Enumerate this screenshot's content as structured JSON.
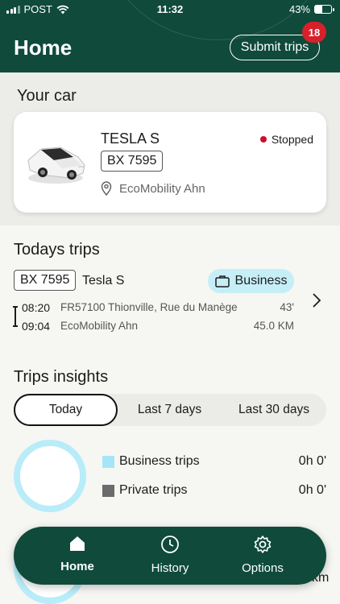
{
  "status_bar": {
    "carrier": "POST",
    "time": "11:32",
    "battery": "43%",
    "battery_fraction": 0.43
  },
  "header": {
    "title": "Home",
    "submit_label": "Submit trips",
    "badge_count": "18"
  },
  "your_car": {
    "section_title": "Your car",
    "name": "TESLA S",
    "plate": "BX 7595",
    "status": "Stopped",
    "location": "EcoMobility Ahn"
  },
  "todays_trips": {
    "section_title": "Todays trips",
    "plate": "BX 7595",
    "car": "Tesla S",
    "category": "Business",
    "start_time": "08:20",
    "start_place": "FR57100 Thionville, Rue du Manège",
    "duration": "43'",
    "end_time": "09:04",
    "end_place": "EcoMobility Ahn",
    "distance": "45.0 KM"
  },
  "insights": {
    "section_title": "Trips insights",
    "tabs": [
      "Today",
      "Last 7 days",
      "Last 30 days"
    ],
    "active_tab": "Today",
    "legend": [
      {
        "label": "Business trips",
        "value": "0h 0'",
        "color": "#a5e6f6"
      },
      {
        "label": "Private trips",
        "value": "0h 0'",
        "color": "#6b6b6b"
      }
    ],
    "partial_value": "km"
  },
  "nav": {
    "items": [
      {
        "label": "Home",
        "icon": "home-icon"
      },
      {
        "label": "History",
        "icon": "clock-icon"
      },
      {
        "label": "Options",
        "icon": "gear-icon"
      }
    ]
  },
  "colors": {
    "brand": "#0f4a3b",
    "accent_light": "#c6eef7",
    "status_red": "#c8102e",
    "badge_red": "#d8202b"
  }
}
